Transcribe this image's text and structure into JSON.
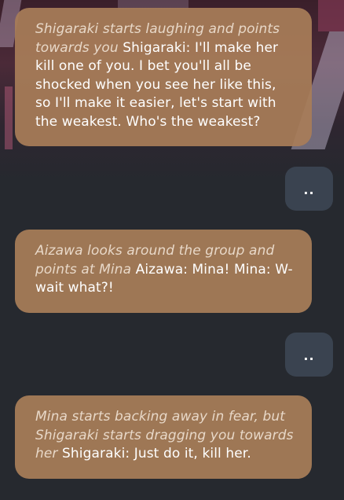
{
  "messages": [
    {
      "role": "character",
      "narration": "Shigaraki starts laughing and points towards you",
      "speech": " Shigaraki: I'll make her kill one of you. I bet you'll all be shocked when you see her like this, so I'll make it easier, let's start with the weakest. Who's the weakest?"
    },
    {
      "role": "user",
      "text": ".."
    },
    {
      "role": "character",
      "narration": "Aizawa looks around the group and points at Mina",
      "speech": " Aizawa: Mina! Mina: W-wait what?!"
    },
    {
      "role": "user",
      "text": ".."
    },
    {
      "role": "character",
      "narration": "Mina starts backing away in fear, but Shigaraki starts dragging you towards her",
      "speech": " Shigaraki: Just do it, kill her."
    }
  ],
  "colors": {
    "background": "#26292f",
    "character_bubble": "#a87d58",
    "user_bubble": "#3a4350",
    "narration_text": "#e8d8c8",
    "speech_text": "#ffffff"
  }
}
